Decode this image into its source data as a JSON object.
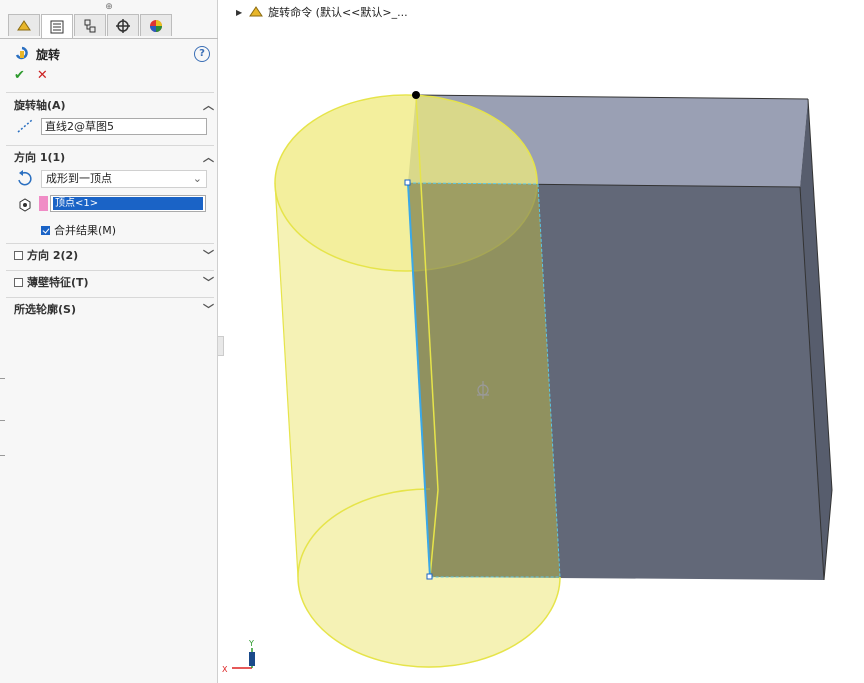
{
  "breadcrumb": {
    "text": "旋转命令 (默认<<默认>_..."
  },
  "panel": {
    "tabs": [
      "feature-manager",
      "property-manager",
      "configuration-manager",
      "dimxpert-manager",
      "display-manager"
    ],
    "title": "旋转",
    "help": "?",
    "ok": "✔",
    "cancel": "✕",
    "axis": {
      "header": "旋转轴(A)",
      "value": "直线2@草图5"
    },
    "direction1": {
      "header": "方向 1(1)",
      "end_condition": "成形到一顶点",
      "vertex": "顶点<1>",
      "merge_label": "合并结果(M)",
      "merge_checked": true
    },
    "direction2": {
      "header": "方向 2(2)"
    },
    "thin": {
      "header": "薄壁特征(T)"
    },
    "contours": {
      "header": "所选轮廓(S)"
    }
  },
  "colors": {
    "accent": "#1a63c6",
    "preview_yellow": "#e6e44a",
    "box_top": "#9aa0b4",
    "box_face": "#616777"
  },
  "triad": {
    "x": "X",
    "y": "Y"
  }
}
